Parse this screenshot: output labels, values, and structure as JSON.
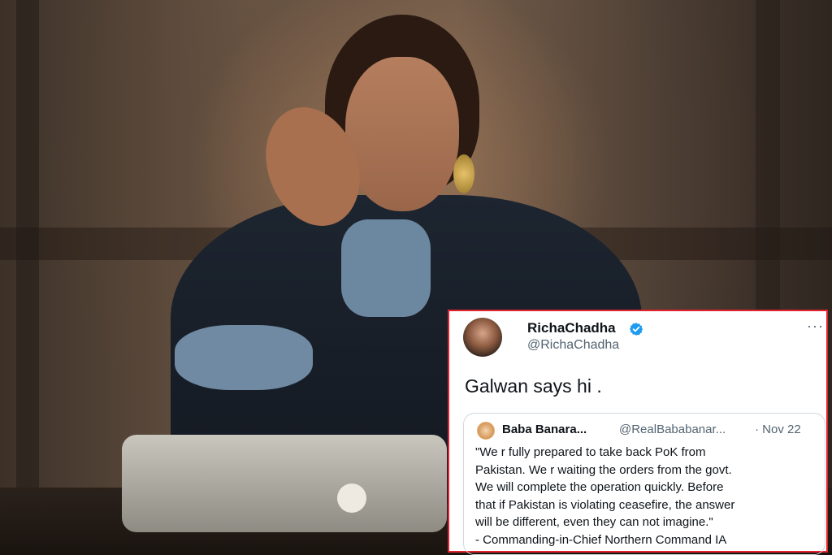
{
  "tweet": {
    "display_name": "RichaChadha",
    "handle": "@RichaChadha",
    "more_icon": "ellipsis-icon",
    "verified_icon": "verified-badge-icon",
    "text": "Galwan says hi .",
    "quote": {
      "name": "Baba Banara...",
      "handle": "@RealBababanar...",
      "date": "· Nov 22",
      "lines": [
        "\"We r fully prepared to take back PoK from",
        "Pakistan. We r waiting the orders from the govt.",
        "We will complete the operation quickly. Before",
        "that if Pakistan is violating ceasefire, the answer",
        "will be different, even they can not imagine.\"",
        "- Commanding-in-Chief Northern Command IA"
      ]
    }
  },
  "colors": {
    "card_border": "#e0232f",
    "verified": "#1d9bf0",
    "text": "#0f1419",
    "muted": "#536471"
  }
}
